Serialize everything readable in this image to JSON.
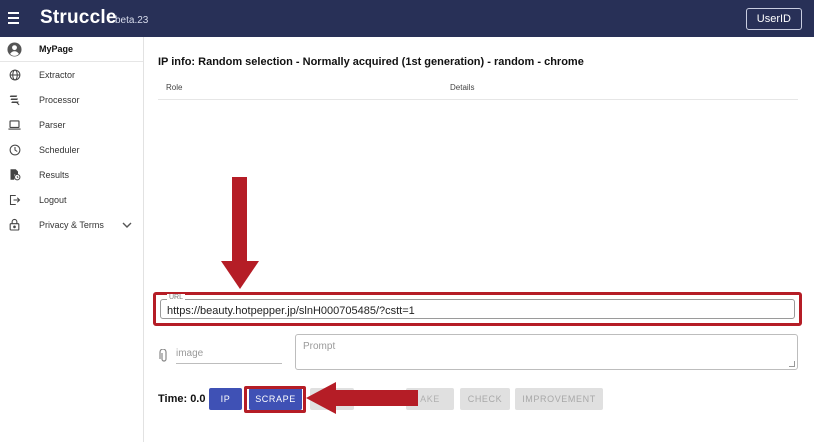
{
  "header": {
    "brand": "Struccle",
    "version": "beta.23",
    "user_button": "UserID"
  },
  "sidebar": {
    "items": [
      {
        "label": "MyPage",
        "icon": "account-circle-icon"
      },
      {
        "label": "Extractor",
        "icon": "globe-icon"
      },
      {
        "label": "Processor",
        "icon": "layers-icon"
      },
      {
        "label": "Parser",
        "icon": "laptop-icon"
      },
      {
        "label": "Scheduler",
        "icon": "clock-icon"
      },
      {
        "label": "Results",
        "icon": "file-clock-icon"
      },
      {
        "label": "Logout",
        "icon": "logout-icon"
      },
      {
        "label": "Privacy & Terms",
        "icon": "lock-icon"
      }
    ]
  },
  "main": {
    "ip_info": "IP info: Random selection - Normally acquired (1st generation) - random - chrome",
    "table": {
      "columns": [
        "Role",
        "Details"
      ]
    },
    "url": {
      "label": "URL",
      "value": "https://beauty.hotpepper.jp/slnH000705485/?cstt=1"
    },
    "image_placeholder": "image",
    "prompt_placeholder": "Prompt",
    "time_label": "Time: 0.0",
    "buttons": {
      "ip": "IP",
      "scrape": "SCRAPE",
      "make": "AKE",
      "check": "CHECK",
      "improvement": "IMPROVEMENT"
    }
  },
  "colors": {
    "appbar": "#283057",
    "primary": "#3f51b5",
    "annotation_red": "#b51d26",
    "disabled": "#e0e0e0"
  }
}
